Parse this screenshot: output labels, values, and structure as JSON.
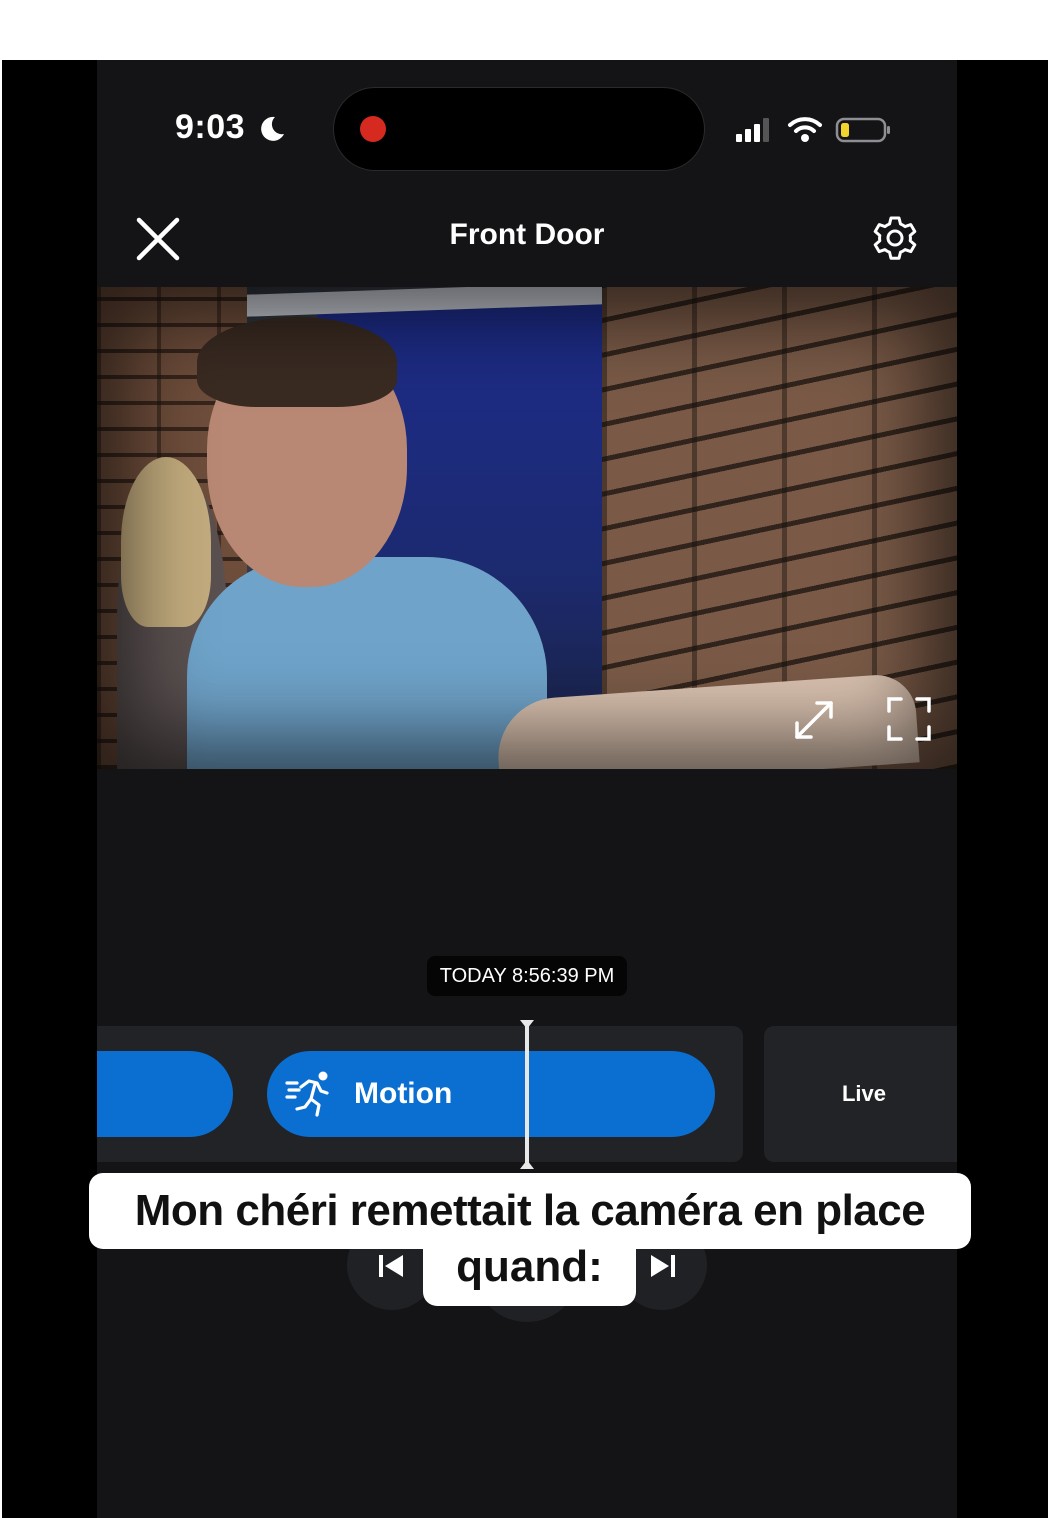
{
  "status_bar": {
    "time": "9:03",
    "icons": [
      "moon-icon",
      "recording-dot",
      "signal-icon",
      "wifi-icon",
      "battery-icon"
    ],
    "recording_color": "#d62a20",
    "battery_color": "#f2d22e"
  },
  "header": {
    "title": "Front Door",
    "close_icon": "close-icon",
    "settings_icon": "gear-icon"
  },
  "video": {
    "controls": [
      "expand-icon",
      "fullscreen-icon"
    ]
  },
  "timeline": {
    "timestamp": "TODAY 8:56:39 PM",
    "event_label": "Motion",
    "event_icon": "running-person-icon",
    "event_color": "#0a6fd1",
    "live_label": "Live"
  },
  "playback": {
    "prev_icon": "skip-previous-icon",
    "next_icon": "skip-next-icon"
  },
  "caption": {
    "line1": "Mon chéri remettait la caméra en place",
    "line2": "quand:"
  }
}
